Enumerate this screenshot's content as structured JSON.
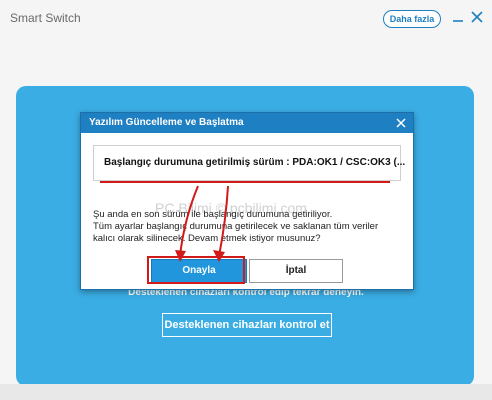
{
  "app": {
    "title": "Smart Switch",
    "more_label": "Daha fazla"
  },
  "background": {
    "check_message": "Desteklenen cihazları kontrol edip tekrar deneyin.",
    "check_button": "Desteklenen cihazları kontrol et"
  },
  "dialog": {
    "title": "Yazılım Güncelleme ve Başlatma",
    "version_line": "Başlangıç durumuna getirilmiş sürüm : PDA:OK1 / CSC:OK3 (...",
    "message_lines": [
      "Şu anda en son sürüm ile başlangıç durumuna getiriliyor.",
      "Tüm ayarlar başlangıç durumuna getirilecek ve saklanan tüm veriler",
      "kalıcı olarak silinecek. Devam etmek istiyor musunuz?"
    ],
    "confirm_label": "Onayla",
    "cancel_label": "İptal"
  },
  "watermark": "PC Bilimi © pcbilimi.com",
  "colors": {
    "accent": "#1e7fc2",
    "card": "#3aade4",
    "annotation": "#d11a1a"
  },
  "icons": {
    "minimize": "minimize-icon",
    "close": "close-icon",
    "dialog_close": "close-icon"
  }
}
